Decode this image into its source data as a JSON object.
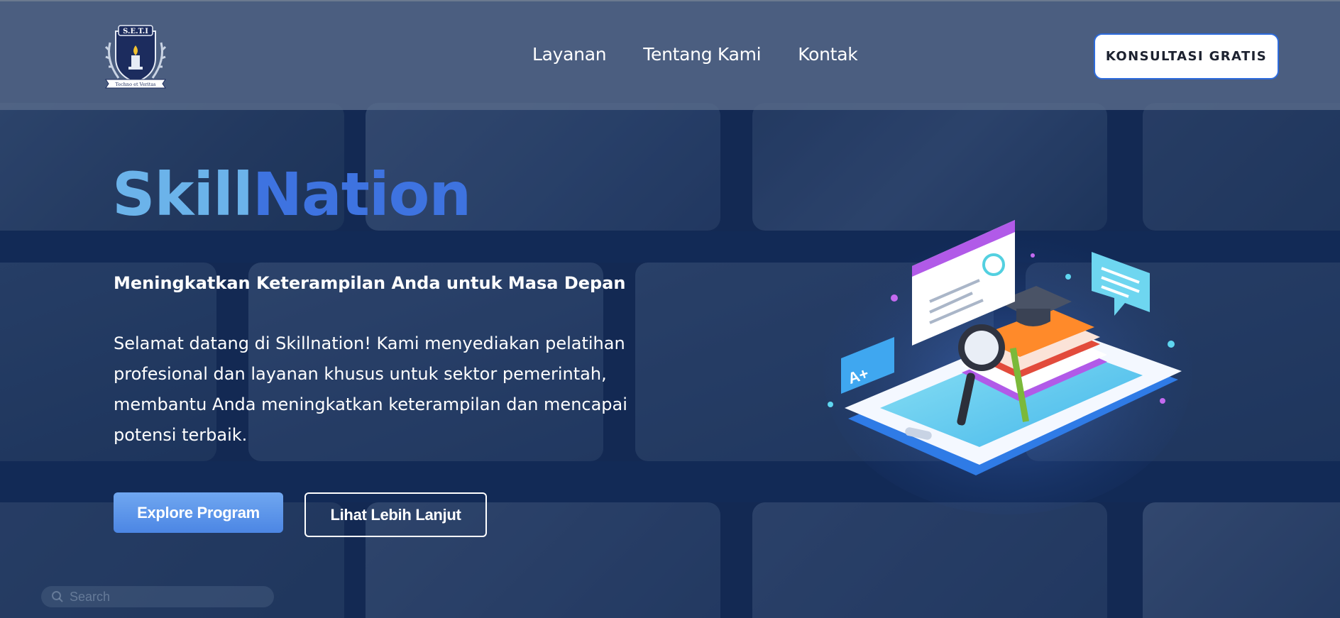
{
  "header": {
    "logo": {
      "icon": "seti-crest-icon",
      "text_top": "S.E.T.I",
      "text_ribbon": "Techno et Veritas"
    },
    "nav": [
      {
        "label": "Layanan"
      },
      {
        "label": "Tentang Kami"
      },
      {
        "label": "Kontak"
      }
    ],
    "cta_label": "KONSULTASI GRATIS"
  },
  "hero": {
    "brand_part1": "Skill",
    "brand_part2": "Nation",
    "subtitle": "Meningkatkan Keterampilan Anda untuk Masa Depan",
    "description": "Selamat datang di Skillnation! Kami menyediakan pelatihan profesional dan layanan khusus untuk sektor pemerintah, membantu Anda meningkatkan keterampilan dan mencapai potensi terbaik.",
    "primary_button": "Explore Program",
    "secondary_button": "Lihat Lebih Lanjut",
    "illustration": "online-learning-phone-illustration",
    "illustration_badge": "A+"
  },
  "background_search": {
    "placeholder": "Search"
  },
  "colors": {
    "brand_light": "#6bb3ea",
    "brand_dark": "#3e73e0",
    "background": "#17305e",
    "header": "#586a8a",
    "cta_border": "#2d6bdc"
  }
}
